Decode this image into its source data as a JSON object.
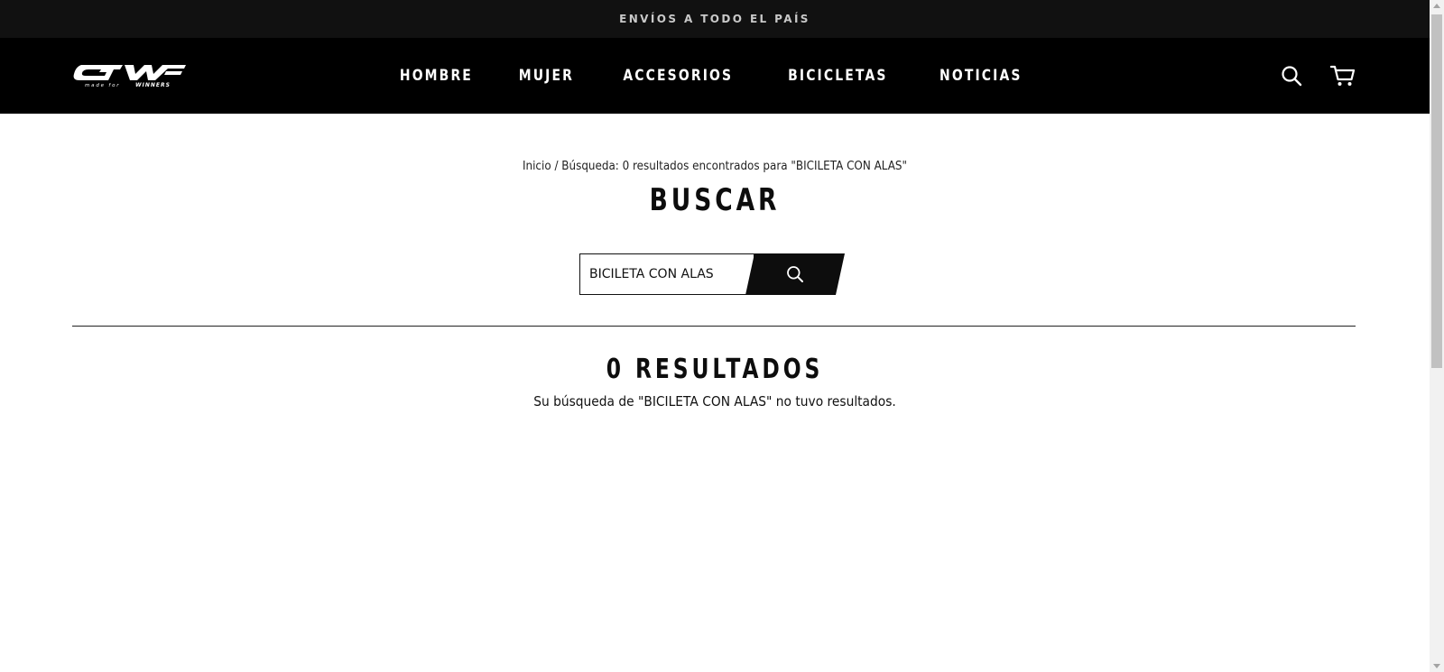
{
  "announcement": {
    "text": "ENVÍOS A TODO EL PAÍS"
  },
  "header": {
    "logo": {
      "icon": "gw-logo",
      "text": "GW",
      "tagline": "made for WINNERS"
    },
    "nav": [
      {
        "label": "HOMBRE"
      },
      {
        "label": "MUJER"
      },
      {
        "label": "ACCESORIOS"
      },
      {
        "label": "BICICLETAS"
      },
      {
        "label": "NOTICIAS"
      }
    ],
    "search_icon": "search-icon",
    "cart_icon": "cart-icon"
  },
  "breadcrumb": {
    "home": "Inicio",
    "separator": " / ",
    "current": "Búsqueda: 0 resultados encontrados para \"BICILETA CON ALAS\""
  },
  "page_title": "BUSCAR",
  "search": {
    "value": "BICILETA CON ALAS",
    "submit_icon": "search-icon"
  },
  "results": {
    "title": "0 RESULTADOS",
    "message": "Su búsqueda de \"BICILETA CON ALAS\" no tuvo resultados."
  },
  "colors": {
    "announcement_bg": "#111111",
    "header_bg": "#000000",
    "accent": "#0d0d0d",
    "page_bg": "#ffffff"
  }
}
